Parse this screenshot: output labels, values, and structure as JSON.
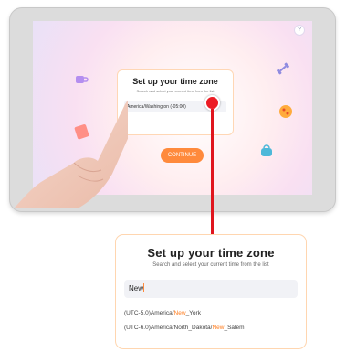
{
  "tablet": {
    "badge_icon": "help-icon",
    "modal": {
      "title": "Set up your time zone",
      "subtitle": "Search and select your current time from the list",
      "field_value": "America/Washington (-05:00)"
    },
    "continue_label": "CONTINUE"
  },
  "callout": {
    "title": "Set up your time zone",
    "subtitle": "Search and select your current time from the list",
    "search_value": "New",
    "options": [
      {
        "prefix": "(UTC-5.0)America/",
        "match": "New",
        "suffix": "_York"
      },
      {
        "prefix": "(UTC-6.0)America/North_Dakota/",
        "match": "New",
        "suffix": "_Salem"
      }
    ]
  },
  "colors": {
    "accent": "#ff8a3c",
    "marker": "#ec1c24",
    "modal_border": "#ffd6b0"
  }
}
